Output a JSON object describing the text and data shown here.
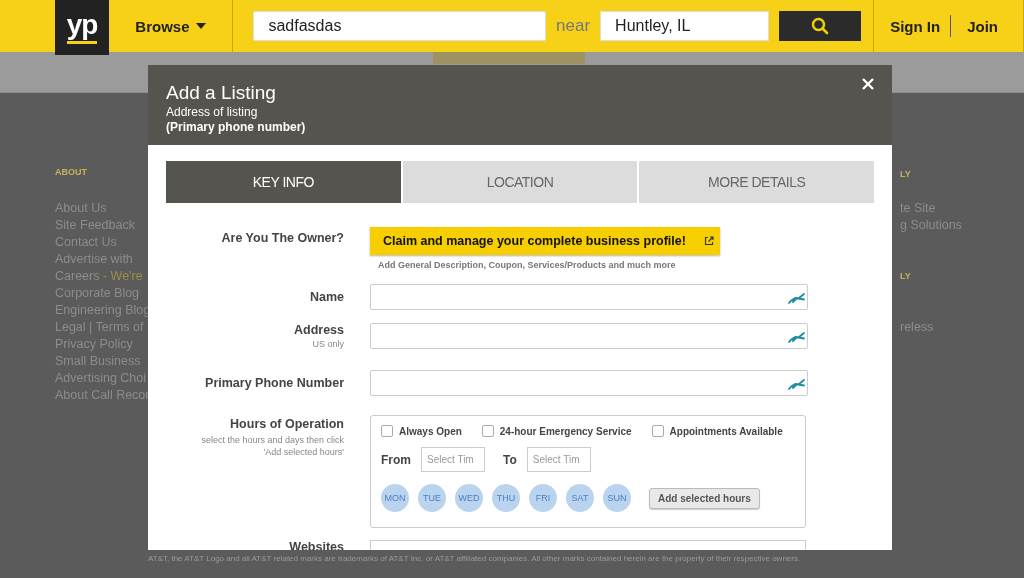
{
  "header": {
    "logo": "yp",
    "browse": "Browse",
    "search": {
      "value": "sadfasdas"
    },
    "near": "near",
    "location": {
      "value": "Huntley, IL"
    },
    "sign_in": "Sign In",
    "join": "Join"
  },
  "footer_left": {
    "heading": "ABOUT",
    "links": [
      {
        "text": "About Us"
      },
      {
        "text": "Site Feedback"
      },
      {
        "text": "Contact Us"
      },
      {
        "text": "Advertise with"
      },
      {
        "text": "Careers",
        "highlight": " - We're"
      },
      {
        "text": "Corporate Blog"
      },
      {
        "text": "Engineering Blog"
      },
      {
        "text": "Legal | Terms of"
      },
      {
        "text": "Privacy Policy"
      },
      {
        "text": "Small Business"
      },
      {
        "text": "Advertising Choi"
      },
      {
        "text": "About Call Recor"
      }
    ]
  },
  "footer_right": [
    {
      "kind": "heading",
      "text": "LY"
    },
    {
      "kind": "gap"
    },
    {
      "kind": "link",
      "text": "te Site"
    },
    {
      "kind": "link",
      "text": "g Solutions"
    },
    {
      "kind": "gap"
    },
    {
      "kind": "gap"
    },
    {
      "kind": "heading",
      "text": "LY"
    },
    {
      "kind": "gap"
    },
    {
      "kind": "gap"
    },
    {
      "kind": "link",
      "text": "reless"
    }
  ],
  "modal": {
    "title": "Add a Listing",
    "subtitle": "Address of listing",
    "subtitle_bold": "(Primary phone number)",
    "tabs": [
      {
        "label": "KEY INFO",
        "selected": true
      },
      {
        "label": "LOCATION",
        "selected": false
      },
      {
        "label": "MORE DETAILS",
        "selected": false
      }
    ],
    "owner": {
      "label": "Are You The Owner?",
      "button": "Claim and manage your complete business profile!",
      "note": "Add General Description, Coupon, Services/Products and much more"
    },
    "fields": [
      {
        "label": "Name"
      },
      {
        "label": "Address",
        "hint": "US only"
      },
      {
        "label": "Primary Phone Number"
      }
    ],
    "hours": {
      "label": "Hours of Operation",
      "hint": "select the hours and days then click 'Add selected hours'",
      "options": [
        {
          "label": "Always Open",
          "checked": false
        },
        {
          "label": "24-hour Emergency Service",
          "checked": false
        },
        {
          "label": "Appointments Available",
          "checked": false
        }
      ],
      "from": "From",
      "from_placeholder": "Select Tim",
      "to": "To",
      "to_placeholder": "Select Tim",
      "days": [
        {
          "label": "MON",
          "selected": false
        },
        {
          "label": "TUE",
          "selected": false
        },
        {
          "label": "WED",
          "selected": false
        },
        {
          "label": "THU",
          "selected": false
        },
        {
          "label": "FRI",
          "selected": false
        },
        {
          "label": "SAT",
          "selected": false
        },
        {
          "label": "SUN",
          "selected": false
        }
      ],
      "add_button": "Add selected hours"
    },
    "websites_label": "Websites"
  },
  "legal": "AT&T, the AT&T Logo and all AT&T related marks are trademarks of AT&T Inc. or AT&T affiliated companies. All other marks contained herein are the property of their respective owners."
}
